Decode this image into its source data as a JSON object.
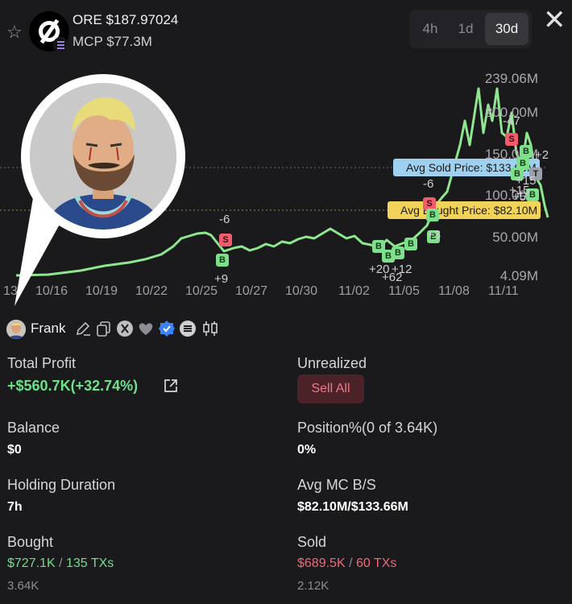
{
  "header": {
    "star_icon": "star-outline-icon",
    "token_name": "ORE $187.97024",
    "mcp": "MCP $77.3M",
    "timeframes": [
      "4h",
      "1d",
      "30d"
    ],
    "active_timeframe": "30d",
    "close_icon": "close-x-icon"
  },
  "chart": {
    "x_ticks": [
      "13",
      "10/16",
      "10/19",
      "10/22",
      "10/25",
      "10/27",
      "10/30",
      "11/02",
      "11/05",
      "11/08",
      "11/11"
    ],
    "y_ticks": [
      "239.06M",
      "200.00M",
      "150.00M",
      "100.00M",
      "50.00M",
      "4.09M"
    ],
    "avg_sold_label": "Avg Sold Price: $133.66M",
    "avg_bought_label": "Avg Bought Price: $82.10M",
    "trade_counts": [
      "-6",
      "+9",
      "-6",
      "+3",
      "+20",
      "+12",
      "+62",
      "-47",
      "+15",
      "+15",
      "+5",
      "+2"
    ],
    "line_color": "#8ee68e",
    "buy_color": "#7ee08a",
    "sell_color": "#f05c6c"
  },
  "user": {
    "name": "Frank",
    "icons": [
      "edit-icon",
      "copy-icon",
      "x-twitter-icon",
      "heart-icon",
      "verified-badge-icon",
      "list-icon",
      "candlestick-icon"
    ]
  },
  "stats": {
    "total_profit_label": "Total Profit",
    "total_profit_value": "+$560.7K(+32.74%)",
    "unrealized_label": "Unrealized",
    "sell_all_label": "Sell All",
    "balance_label": "Balance",
    "balance_value": "$0",
    "position_label": "Position%(0 of 3.64K)",
    "position_value": "0%",
    "holding_label": "Holding Duration",
    "holding_value": "7h",
    "avg_mc_label": "Avg MC B/S",
    "avg_mc_value": "$82.10M/$133.66M",
    "bought_label": "Bought",
    "bought_amount": "$727.1K",
    "bought_sep": "/",
    "bought_txs": "135 TXs",
    "bought_tokens": "3.64K",
    "sold_label": "Sold",
    "sold_amount": "$689.5K",
    "sold_sep": "/",
    "sold_txs": "60 TXs",
    "sold_tokens": "2.12K"
  }
}
